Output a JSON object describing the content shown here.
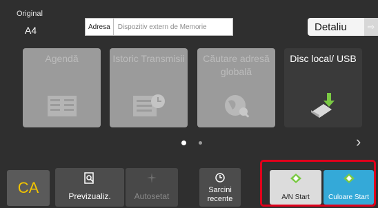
{
  "header": {
    "original_label": "Original",
    "original_size": "A4",
    "address_label": "Adresa",
    "address_placeholder": "Dispozitiv extern de Memorie",
    "detail_label": "Detaliu"
  },
  "tiles": [
    {
      "label": "Agendă",
      "enabled": false
    },
    {
      "label": "Istoric Transmisii",
      "enabled": false
    },
    {
      "label": "Căutare adresă globală",
      "enabled": false
    },
    {
      "label": "Disc local/ USB",
      "enabled": true
    }
  ],
  "pager": {
    "current": 1,
    "total": 2
  },
  "bottom": {
    "ca_label": "CA",
    "preview_label": "Previzualiz.",
    "autoset_label": "Autosetat",
    "recent_jobs_label": "Sarcini recente",
    "bw_start_label": "A/N Start",
    "color_start_label": "Culoare Start"
  },
  "colors": {
    "accent_ca": "#f2c400",
    "highlight_frame": "#e0001b",
    "color_start_bg": "#34a9d8",
    "start_diamond": "#7ac943"
  }
}
